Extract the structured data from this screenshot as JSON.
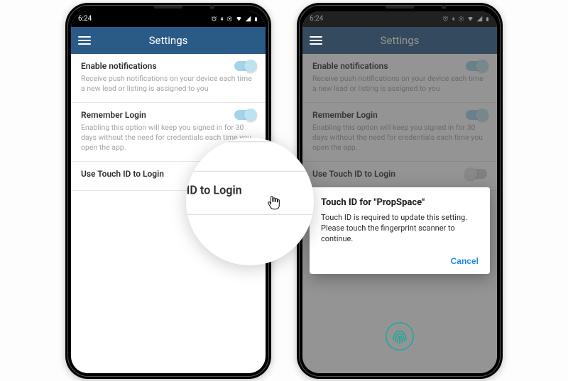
{
  "statusbar": {
    "time": "6:24"
  },
  "appbar": {
    "title": "Settings"
  },
  "settings": {
    "notifications": {
      "label": "Enable notifications",
      "desc": "Receive push notifications on your device each time a new lead or listing is assigned to you"
    },
    "remember": {
      "label": "Remember Login",
      "desc": "Enabling this option will keep you signed in for 30 days without the need for credentials each time you open the app."
    },
    "touchid": {
      "label": "Use Touch ID to Login"
    }
  },
  "dialog": {
    "title": "Touch ID for \"PropSpace\"",
    "body": "Touch ID is required to update this setting. Please touch the fingerprint scanner to continue.",
    "cancel": "Cancel"
  },
  "colors": {
    "appbar": "#2a5b87",
    "link": "#1e88e5",
    "fingerprint": "#1aa89e"
  }
}
